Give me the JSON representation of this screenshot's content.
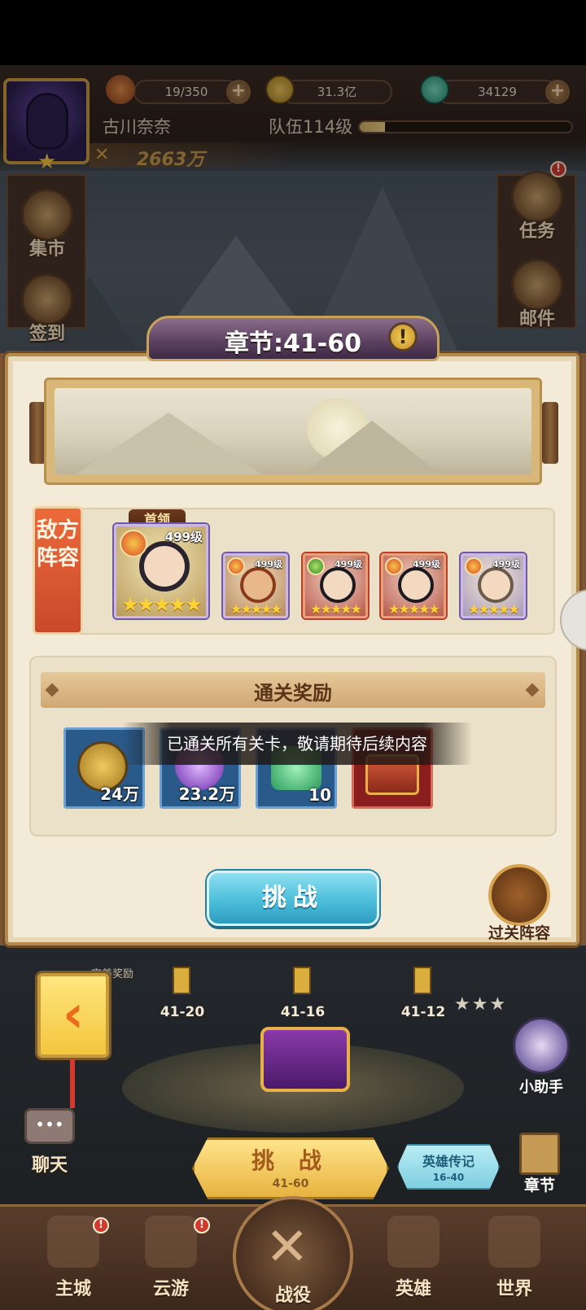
{
  "hud": {
    "stamina": "19/350",
    "coins": "31.3亿",
    "gems": "34129",
    "player_name": "古川奈奈",
    "team_level": "队伍114级",
    "team_exp_fraction": 0.12,
    "power": "2663万"
  },
  "side_menu": {
    "market": "集市",
    "signin": "签到",
    "tasks": "任务",
    "mail": "邮件",
    "task_badge": "!"
  },
  "modal": {
    "title": "章节:41-60",
    "info_badge": "!",
    "enemy_tag": "敌方阵容",
    "boss_label": "首领",
    "enemies": [
      {
        "level": "499级",
        "stars": "★★★★★",
        "boss": true
      },
      {
        "level": "499级",
        "stars": "★★★★★"
      },
      {
        "level": "499级",
        "stars": "★★★★★"
      },
      {
        "level": "499级",
        "stars": "★★★★★"
      },
      {
        "level": "499级",
        "stars": "★★★★★"
      }
    ],
    "reward_header": "通关奖励",
    "rewards": [
      {
        "count": "24万"
      },
      {
        "count": "23.2万"
      },
      {
        "count": "10"
      },
      {
        "count": ""
      }
    ],
    "toast": "已通关所有关卡，敬请期待后续内容",
    "challenge_button": "挑战",
    "clear_lineup": "过关阵容"
  },
  "map": {
    "perfect_reward": "完美奖励",
    "stages": [
      "41-20",
      "41-16",
      "41-12"
    ],
    "chat": "聊天",
    "chat_dots": "•••",
    "challenge": "挑 战",
    "challenge_range": "41-60",
    "legend": "英雄传记",
    "legend_range": "16-40",
    "helper": "小助手",
    "chapter": "章节",
    "stars": "★★★"
  },
  "bottom_nav": {
    "main_city": "主城",
    "travel": "云游",
    "battle": "战役",
    "heroes": "英雄",
    "world": "世界",
    "main_city_badge": "!",
    "travel_badge": "!"
  },
  "colors": {
    "accent_blue": "#4cbedb",
    "enemy_tag": "#ec6a3a",
    "gold": "#f3c53c"
  }
}
